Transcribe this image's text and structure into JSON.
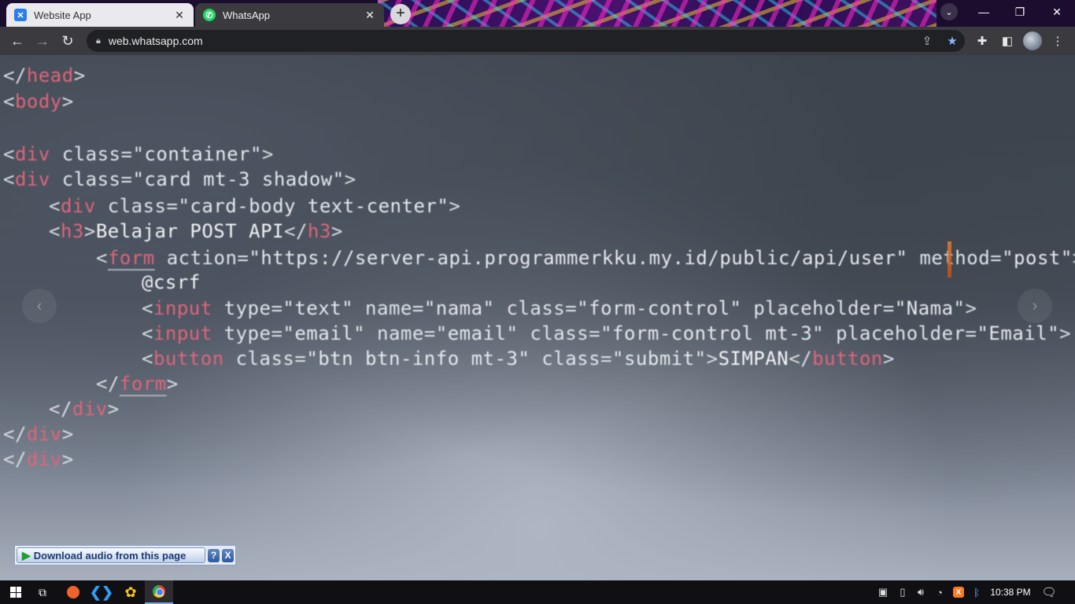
{
  "browser": {
    "tabs": [
      {
        "title": "Website App",
        "favicon": "website-app-icon",
        "active": false
      },
      {
        "title": "WhatsApp",
        "favicon": "whatsapp-icon",
        "active": true
      }
    ],
    "new_tab_label": "+",
    "url": "web.whatsapp.com",
    "window_controls": {
      "search": "⌄",
      "minimize": "—",
      "maximize": "❐",
      "close": "✕"
    }
  },
  "code_lines": [
    {
      "indent": 0,
      "parts": [
        [
          "punc",
          "</"
        ],
        [
          "tag",
          "head"
        ],
        [
          "punc",
          ">"
        ]
      ]
    },
    {
      "indent": 0,
      "parts": [
        [
          "punc",
          "<"
        ],
        [
          "tag",
          "body"
        ],
        [
          "punc",
          ">"
        ]
      ]
    },
    {
      "indent": 0,
      "parts": [
        [
          "punc",
          "<"
        ],
        [
          "tag",
          "div"
        ],
        [
          "attr",
          " class="
        ],
        [
          "str",
          "\"container\""
        ],
        [
          "punc",
          ">"
        ]
      ]
    },
    {
      "indent": 0,
      "parts": [
        [
          "punc",
          "<"
        ],
        [
          "tag",
          "div"
        ],
        [
          "attr",
          " class="
        ],
        [
          "str",
          "\"card mt-3 shadow\""
        ],
        [
          "punc",
          ">"
        ]
      ]
    },
    {
      "indent": 1,
      "parts": [
        [
          "punc",
          "<"
        ],
        [
          "tag",
          "div"
        ],
        [
          "attr",
          " class="
        ],
        [
          "str",
          "\"card-body text-center\""
        ],
        [
          "punc",
          ">"
        ]
      ]
    },
    {
      "indent": 1,
      "parts": [
        [
          "punc",
          "<"
        ],
        [
          "tag",
          "h3"
        ],
        [
          "punc",
          ">"
        ],
        [
          "txt",
          "Belajar POST API"
        ],
        [
          "punc",
          "</"
        ],
        [
          "tag",
          "h3"
        ],
        [
          "punc",
          ">"
        ]
      ]
    },
    {
      "indent": 2,
      "parts": [
        [
          "punc",
          "<"
        ],
        [
          "tag",
          "form"
        ],
        [
          "attr",
          " action="
        ],
        [
          "str",
          "\"https://server-api.programmerkku.my.id/public/api/user\""
        ],
        [
          "attr",
          " method="
        ],
        [
          "str",
          "\"post\""
        ],
        [
          "punc",
          ">"
        ]
      ]
    },
    {
      "indent": 3,
      "parts": [
        [
          "txt",
          "@csrf"
        ]
      ]
    },
    {
      "indent": 3,
      "parts": [
        [
          "punc",
          "<"
        ],
        [
          "tag",
          "input"
        ],
        [
          "attr",
          " type="
        ],
        [
          "str",
          "\"text\""
        ],
        [
          "attr",
          " name="
        ],
        [
          "str",
          "\"nama\""
        ],
        [
          "attr",
          " class="
        ],
        [
          "str",
          "\"form-control\""
        ],
        [
          "attr",
          " placeholder="
        ],
        [
          "str",
          "\"Nama\""
        ],
        [
          "punc",
          ">"
        ]
      ]
    },
    {
      "indent": 3,
      "parts": [
        [
          "punc",
          "<"
        ],
        [
          "tag",
          "input"
        ],
        [
          "attr",
          " type="
        ],
        [
          "str",
          "\"email\""
        ],
        [
          "attr",
          " name="
        ],
        [
          "str",
          "\"email\""
        ],
        [
          "attr",
          " class="
        ],
        [
          "str",
          "\"form-control mt-3\""
        ],
        [
          "attr",
          " placeholder="
        ],
        [
          "str",
          "\"Email\""
        ],
        [
          "punc",
          ">"
        ]
      ]
    },
    {
      "indent": 3,
      "parts": [
        [
          "punc",
          "<"
        ],
        [
          "tag",
          "button"
        ],
        [
          "attr",
          " class="
        ],
        [
          "str",
          "\"btn btn-info mt-3\""
        ],
        [
          "attr",
          " class="
        ],
        [
          "str",
          "\"submit\""
        ],
        [
          "punc",
          ">"
        ],
        [
          "txt",
          "SIMPAN"
        ],
        [
          "punc",
          "</"
        ],
        [
          "tag",
          "button"
        ],
        [
          "punc",
          ">"
        ]
      ]
    },
    {
      "indent": 2,
      "parts": [
        [
          "punc",
          "</"
        ],
        [
          "tag",
          "form"
        ],
        [
          "punc",
          ">"
        ]
      ]
    },
    {
      "indent": 1,
      "parts": [
        [
          "punc",
          "</"
        ],
        [
          "tag",
          "div"
        ],
        [
          "punc",
          ">"
        ]
      ]
    },
    {
      "indent": 0,
      "parts": [
        [
          "punc",
          "</"
        ],
        [
          "tag",
          "div"
        ],
        [
          "punc",
          ">"
        ]
      ]
    },
    {
      "indent": 0,
      "parts": [
        [
          "punc",
          "</"
        ],
        [
          "tag",
          "div"
        ],
        [
          "punc",
          ">"
        ]
      ]
    }
  ],
  "viewer": {
    "prev_label": "‹",
    "next_label": "›"
  },
  "download_bar": {
    "label": "Download audio from this page",
    "help": "?",
    "close": "X"
  },
  "taskbar": {
    "time": "10:38 PM",
    "xampp_label": "X"
  },
  "colors": {
    "tag": "#e0647a",
    "accent": "#8ab4f8",
    "whatsapp": "#25d366"
  }
}
